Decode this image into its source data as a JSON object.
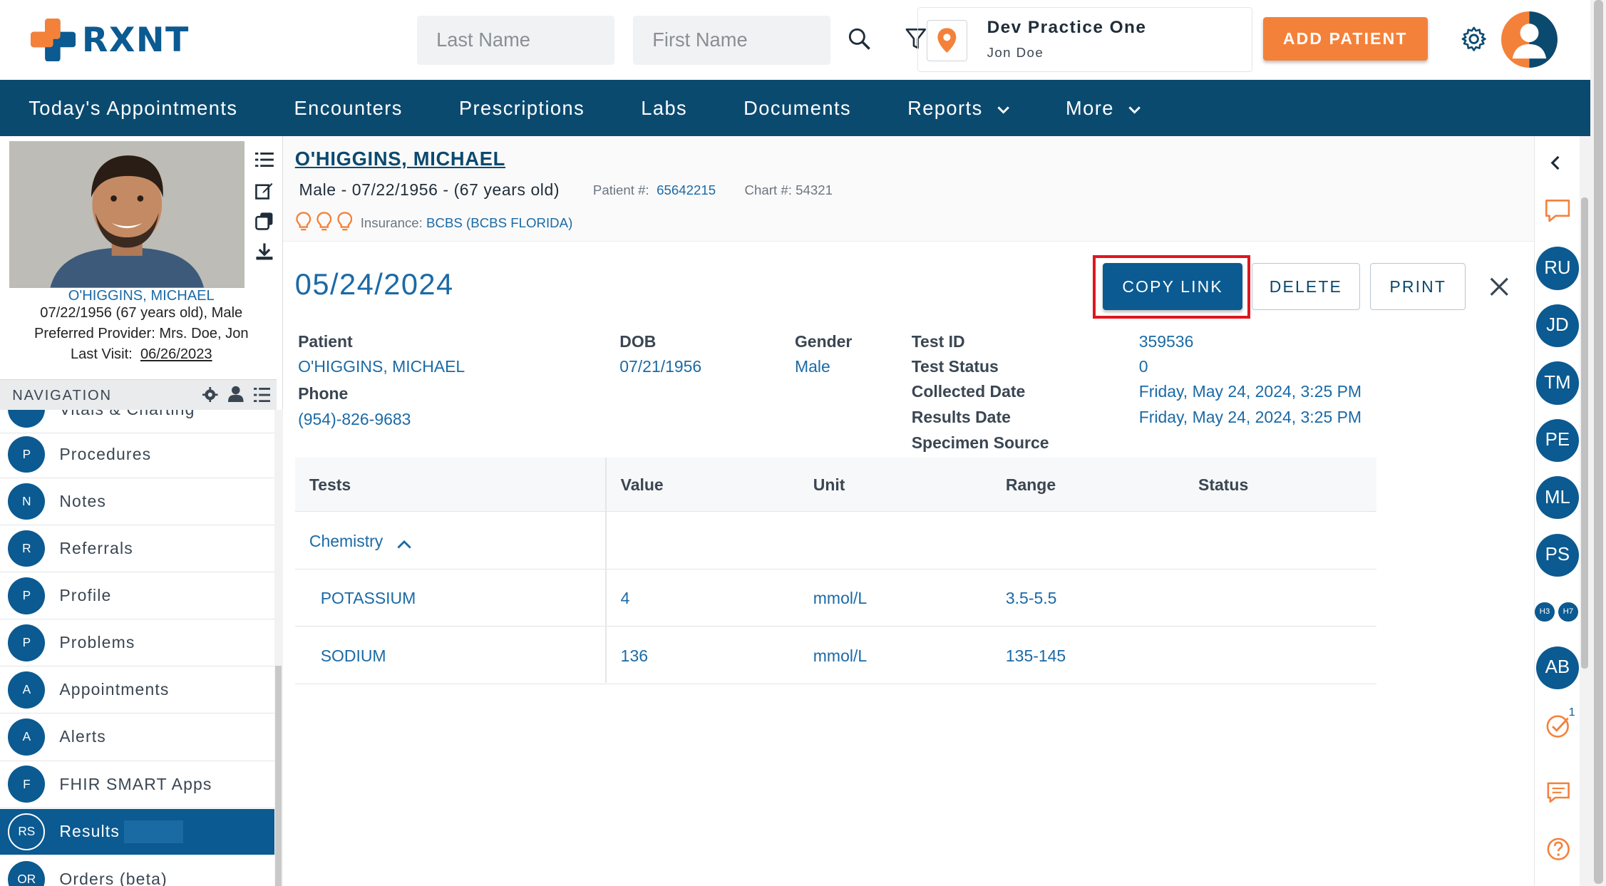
{
  "header": {
    "logo_text": "RXNT",
    "last_name_placeholder": "Last Name",
    "first_name_placeholder": "First Name",
    "practice_name": "Dev Practice One",
    "practice_user": "Jon Doe",
    "add_patient_label": "ADD PATIENT",
    "brand_color": "#0b5a91",
    "accent_color": "#f4813a"
  },
  "navbar": {
    "items": [
      {
        "label": "Today's Appointments"
      },
      {
        "label": "Encounters"
      },
      {
        "label": "Prescriptions"
      },
      {
        "label": "Labs"
      },
      {
        "label": "Documents"
      },
      {
        "label": "Reports",
        "has_menu": true
      },
      {
        "label": "More",
        "has_menu": true
      }
    ]
  },
  "sidebar": {
    "patient_name": "O'HIGGINS, MICHAEL",
    "dob_line": "07/22/1956 (67 years old), Male",
    "provider_line": "Preferred Provider: Mrs. Doe, Jon",
    "last_visit_label": "Last Visit:",
    "last_visit_value": "06/26/2023",
    "navigation_label": "NAVIGATION",
    "partial_item": "Vitals & Charting",
    "items": [
      {
        "initials": "P",
        "label": "Procedures"
      },
      {
        "initials": "N",
        "label": "Notes"
      },
      {
        "initials": "R",
        "label": "Referrals"
      },
      {
        "initials": "P",
        "label": "Profile"
      },
      {
        "initials": "P",
        "label": "Problems"
      },
      {
        "initials": "A",
        "label": "Appointments"
      },
      {
        "initials": "A",
        "label": "Alerts"
      },
      {
        "initials": "F",
        "label": "FHIR SMART Apps"
      },
      {
        "initials": "RS",
        "label": "Results",
        "active": true
      },
      {
        "initials": "OR",
        "label": "Orders (beta)"
      }
    ]
  },
  "patient_header": {
    "name": "O'HIGGINS, MICHAEL",
    "demographics": "Male - 07/22/1956 - (67 years old)",
    "patient_num_label": "Patient #:",
    "patient_num": "65642215",
    "chart_num_label": "Chart #:",
    "chart_num": "54321",
    "insurance_label": "Insurance:",
    "insurance": "BCBS (BCBS FLORIDA)"
  },
  "result": {
    "date": "05/24/2024",
    "buttons": {
      "copy_link": "COPY LINK",
      "delete": "DELETE",
      "print": "PRINT"
    },
    "patient_label": "Patient",
    "patient_value": "O'HIGGINS, MICHAEL",
    "phone_label": "Phone",
    "phone_value": "(954)-826-9683",
    "dob_label": "DOB",
    "dob_value": "07/21/1956",
    "gender_label": "Gender",
    "gender_value": "Male",
    "test_id_label": "Test ID",
    "test_id_value": "359536",
    "test_status_label": "Test Status",
    "test_status_value": "0",
    "collected_label": "Collected Date",
    "collected_value": "Friday, May 24, 2024, 3:25 PM",
    "results_date_label": "Results Date",
    "results_date_value": "Friday, May 24, 2024, 3:25 PM",
    "specimen_label": "Specimen Source",
    "specimen_value": ""
  },
  "table": {
    "columns": [
      "Tests",
      "Value",
      "Unit",
      "Range",
      "Status"
    ],
    "group": "Chemistry",
    "rows": [
      {
        "test": "POTASSIUM",
        "value": "4",
        "unit": "mmol/L",
        "range": "3.5-5.5",
        "status": ""
      },
      {
        "test": "SODIUM",
        "value": "136",
        "unit": "mmol/L",
        "range": "135-145",
        "status": ""
      }
    ]
  },
  "right_rail": {
    "users": [
      "RU",
      "JD",
      "TM",
      "PE",
      "ML",
      "PS"
    ],
    "mini": [
      "H3",
      "H7"
    ],
    "last_user": "AB",
    "task_badge": "1"
  }
}
